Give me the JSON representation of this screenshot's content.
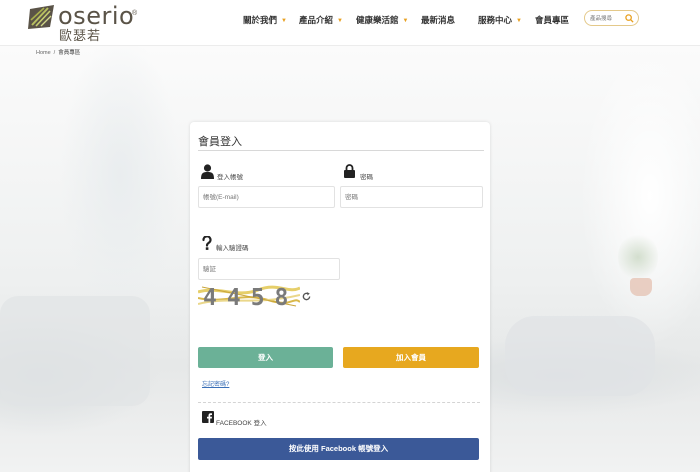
{
  "header": {
    "logo_text": "oserio",
    "logo_reg": "®",
    "logo_sub": "歐瑟若",
    "nav": [
      {
        "label": "關於我們",
        "caret": "▼"
      },
      {
        "label": "產品介紹",
        "caret": "▼"
      },
      {
        "label": "健康樂活館",
        "caret": "▼"
      },
      {
        "label": "最新消息",
        "caret": ""
      },
      {
        "label": "服務中心",
        "caret": "▼"
      },
      {
        "label": "會員專區",
        "caret": ""
      }
    ],
    "search_placeholder": "產品搜尋",
    "search_icon": "search-icon"
  },
  "breadcrumb": {
    "home": "Home",
    "separator": "/",
    "current": "會員專區"
  },
  "login": {
    "title": "會員登入",
    "account_label": "登入帳號",
    "account_placeholder": "帳號(E-mail)",
    "password_label": "密碼",
    "password_placeholder": "密碼",
    "captcha_label": "輸入驗證碼",
    "captcha_placeholder": "驗証",
    "captcha_code": "4458",
    "login_button": "登入",
    "join_button": "加入會員",
    "forgot_link": "忘記密碼?",
    "facebook_label": "FACEBOOK 登入",
    "facebook_button": "按此使用 Facebook 帳號登入"
  },
  "colors": {
    "login_button": "#6bb197",
    "join_button": "#e7a81f",
    "facebook_button": "#3b5998",
    "nav_caret": "#e8a020",
    "link": "#3a6fb7"
  }
}
